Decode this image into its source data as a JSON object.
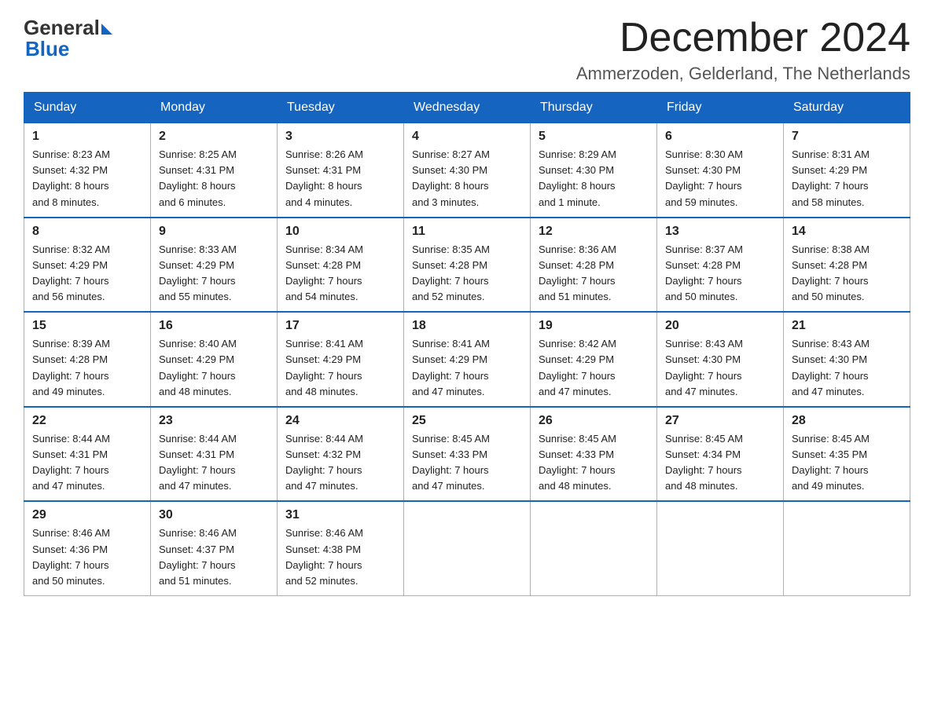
{
  "logo": {
    "text_general": "General",
    "text_blue": "Blue"
  },
  "title": "December 2024",
  "location": "Ammerzoden, Gelderland, The Netherlands",
  "days_of_week": [
    "Sunday",
    "Monday",
    "Tuesday",
    "Wednesday",
    "Thursday",
    "Friday",
    "Saturday"
  ],
  "weeks": [
    [
      {
        "day": "1",
        "info": "Sunrise: 8:23 AM\nSunset: 4:32 PM\nDaylight: 8 hours\nand 8 minutes."
      },
      {
        "day": "2",
        "info": "Sunrise: 8:25 AM\nSunset: 4:31 PM\nDaylight: 8 hours\nand 6 minutes."
      },
      {
        "day": "3",
        "info": "Sunrise: 8:26 AM\nSunset: 4:31 PM\nDaylight: 8 hours\nand 4 minutes."
      },
      {
        "day": "4",
        "info": "Sunrise: 8:27 AM\nSunset: 4:30 PM\nDaylight: 8 hours\nand 3 minutes."
      },
      {
        "day": "5",
        "info": "Sunrise: 8:29 AM\nSunset: 4:30 PM\nDaylight: 8 hours\nand 1 minute."
      },
      {
        "day": "6",
        "info": "Sunrise: 8:30 AM\nSunset: 4:30 PM\nDaylight: 7 hours\nand 59 minutes."
      },
      {
        "day": "7",
        "info": "Sunrise: 8:31 AM\nSunset: 4:29 PM\nDaylight: 7 hours\nand 58 minutes."
      }
    ],
    [
      {
        "day": "8",
        "info": "Sunrise: 8:32 AM\nSunset: 4:29 PM\nDaylight: 7 hours\nand 56 minutes."
      },
      {
        "day": "9",
        "info": "Sunrise: 8:33 AM\nSunset: 4:29 PM\nDaylight: 7 hours\nand 55 minutes."
      },
      {
        "day": "10",
        "info": "Sunrise: 8:34 AM\nSunset: 4:28 PM\nDaylight: 7 hours\nand 54 minutes."
      },
      {
        "day": "11",
        "info": "Sunrise: 8:35 AM\nSunset: 4:28 PM\nDaylight: 7 hours\nand 52 minutes."
      },
      {
        "day": "12",
        "info": "Sunrise: 8:36 AM\nSunset: 4:28 PM\nDaylight: 7 hours\nand 51 minutes."
      },
      {
        "day": "13",
        "info": "Sunrise: 8:37 AM\nSunset: 4:28 PM\nDaylight: 7 hours\nand 50 minutes."
      },
      {
        "day": "14",
        "info": "Sunrise: 8:38 AM\nSunset: 4:28 PM\nDaylight: 7 hours\nand 50 minutes."
      }
    ],
    [
      {
        "day": "15",
        "info": "Sunrise: 8:39 AM\nSunset: 4:28 PM\nDaylight: 7 hours\nand 49 minutes."
      },
      {
        "day": "16",
        "info": "Sunrise: 8:40 AM\nSunset: 4:29 PM\nDaylight: 7 hours\nand 48 minutes."
      },
      {
        "day": "17",
        "info": "Sunrise: 8:41 AM\nSunset: 4:29 PM\nDaylight: 7 hours\nand 48 minutes."
      },
      {
        "day": "18",
        "info": "Sunrise: 8:41 AM\nSunset: 4:29 PM\nDaylight: 7 hours\nand 47 minutes."
      },
      {
        "day": "19",
        "info": "Sunrise: 8:42 AM\nSunset: 4:29 PM\nDaylight: 7 hours\nand 47 minutes."
      },
      {
        "day": "20",
        "info": "Sunrise: 8:43 AM\nSunset: 4:30 PM\nDaylight: 7 hours\nand 47 minutes."
      },
      {
        "day": "21",
        "info": "Sunrise: 8:43 AM\nSunset: 4:30 PM\nDaylight: 7 hours\nand 47 minutes."
      }
    ],
    [
      {
        "day": "22",
        "info": "Sunrise: 8:44 AM\nSunset: 4:31 PM\nDaylight: 7 hours\nand 47 minutes."
      },
      {
        "day": "23",
        "info": "Sunrise: 8:44 AM\nSunset: 4:31 PM\nDaylight: 7 hours\nand 47 minutes."
      },
      {
        "day": "24",
        "info": "Sunrise: 8:44 AM\nSunset: 4:32 PM\nDaylight: 7 hours\nand 47 minutes."
      },
      {
        "day": "25",
        "info": "Sunrise: 8:45 AM\nSunset: 4:33 PM\nDaylight: 7 hours\nand 47 minutes."
      },
      {
        "day": "26",
        "info": "Sunrise: 8:45 AM\nSunset: 4:33 PM\nDaylight: 7 hours\nand 48 minutes."
      },
      {
        "day": "27",
        "info": "Sunrise: 8:45 AM\nSunset: 4:34 PM\nDaylight: 7 hours\nand 48 minutes."
      },
      {
        "day": "28",
        "info": "Sunrise: 8:45 AM\nSunset: 4:35 PM\nDaylight: 7 hours\nand 49 minutes."
      }
    ],
    [
      {
        "day": "29",
        "info": "Sunrise: 8:46 AM\nSunset: 4:36 PM\nDaylight: 7 hours\nand 50 minutes."
      },
      {
        "day": "30",
        "info": "Sunrise: 8:46 AM\nSunset: 4:37 PM\nDaylight: 7 hours\nand 51 minutes."
      },
      {
        "day": "31",
        "info": "Sunrise: 8:46 AM\nSunset: 4:38 PM\nDaylight: 7 hours\nand 52 minutes."
      },
      {
        "day": "",
        "info": ""
      },
      {
        "day": "",
        "info": ""
      },
      {
        "day": "",
        "info": ""
      },
      {
        "day": "",
        "info": ""
      }
    ]
  ]
}
